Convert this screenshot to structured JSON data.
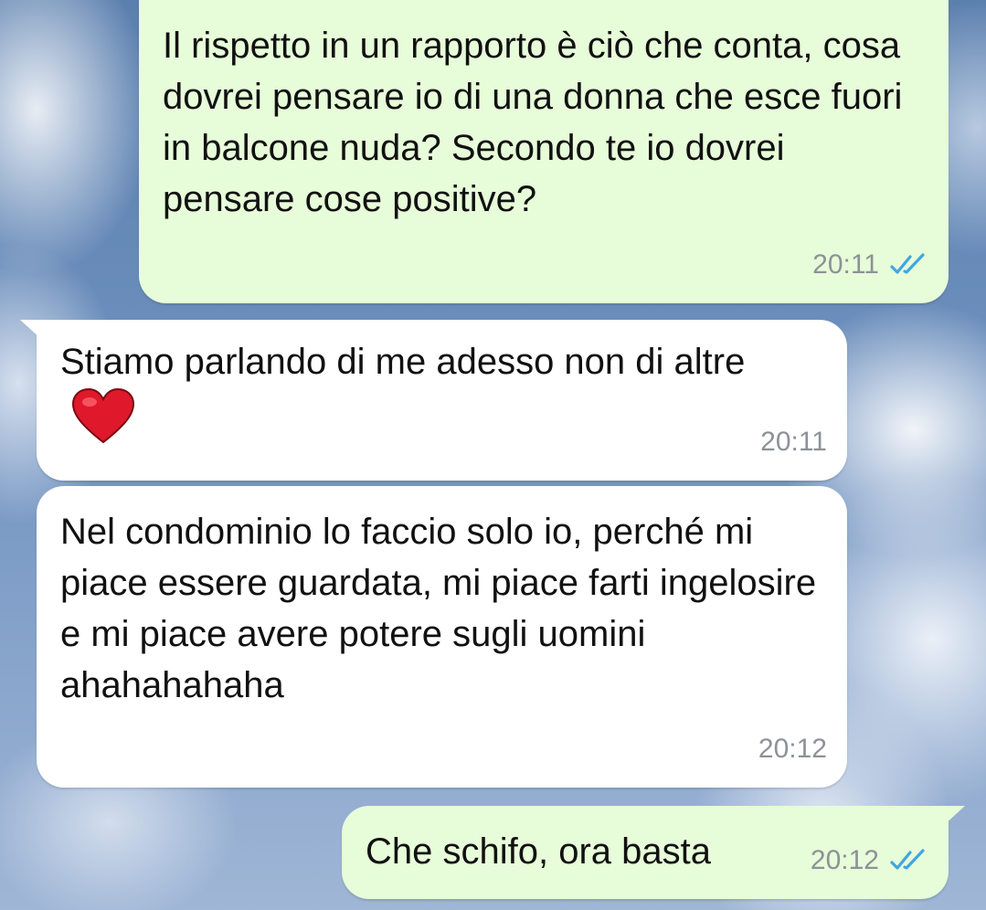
{
  "messages": [
    {
      "direction": "outgoing",
      "text": "Il rispetto in un rapporto è ciò che conta, cosa dovrei pensare io di una donna che esce fuori in balcone nuda? Secondo te io dovrei pensare cose positive?",
      "time": "20:11",
      "status": "read",
      "status_icon": "double-check-icon",
      "status_color": "#3fa7e0"
    },
    {
      "direction": "incoming",
      "text": "Stiamo parlando di me adesso non di altre",
      "emoji": "❤️",
      "emoji_icon": "red-heart-icon",
      "time": "20:11"
    },
    {
      "direction": "incoming",
      "text": "Nel condominio lo faccio solo io, perché mi piace essere guardata, mi piace farti ingelosire e mi piace avere potere sugli uomini ahahahahaha",
      "time": "20:12"
    },
    {
      "direction": "outgoing",
      "text": "Che schifo, ora basta",
      "time": "20:12",
      "status": "read",
      "status_icon": "double-check-icon",
      "status_color": "#3fa7e0"
    }
  ],
  "colors": {
    "outgoing_bubble": "#e7fcd9",
    "incoming_bubble": "#ffffff",
    "timestamp": "#8d9298",
    "read_check": "#3fa7e0"
  }
}
